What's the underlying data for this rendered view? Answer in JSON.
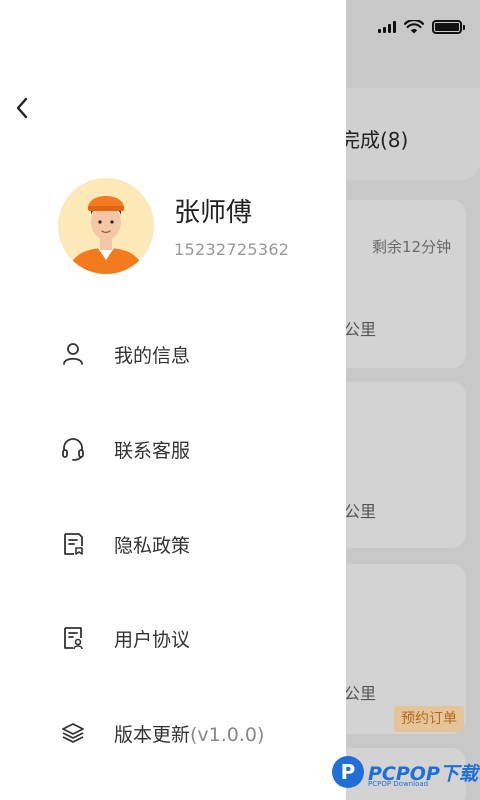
{
  "background": {
    "tab_label": "完成(8)",
    "remaining": "剩余12分钟",
    "distance_unit": "公里",
    "badge": "预约订单"
  },
  "profile": {
    "name": "张师傅",
    "phone": "15232725362"
  },
  "menu": [
    {
      "label": "我的信息",
      "icon": "user-icon"
    },
    {
      "label": "联系客服",
      "icon": "headset-icon"
    },
    {
      "label": "隐私政策",
      "icon": "document-icon"
    },
    {
      "label": "用户协议",
      "icon": "agreement-icon"
    },
    {
      "label": "版本更新",
      "icon": "layers-icon",
      "version": "(v1.0.0)"
    }
  ],
  "watermark": {
    "logo": "P",
    "text": "PCPOP下载",
    "sub": "PCPOP Download"
  },
  "colors": {
    "avatar_bg": "#fde9b8",
    "accent_orange": "#f47a20",
    "badge_text": "#b36a1a"
  }
}
